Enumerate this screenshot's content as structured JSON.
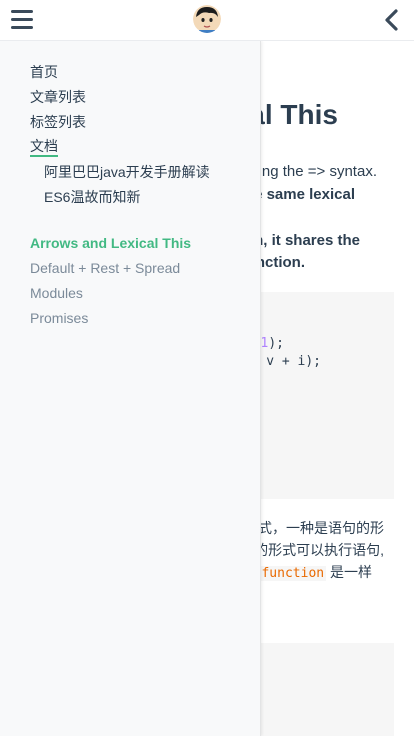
{
  "navbar": {
    "menu_icon": "hamburger-icon",
    "avatar_icon": "avatar",
    "back_icon": "chevron-left-icon"
  },
  "sidebar": {
    "items": [
      {
        "label": "首页"
      },
      {
        "label": "文章列表"
      },
      {
        "label": "标签列表"
      },
      {
        "label": "文档",
        "active": true
      }
    ],
    "sub_items": [
      {
        "label": "阿里巴巴java开发手册解读"
      },
      {
        "label": "ES6温故而知新"
      }
    ],
    "toc": [
      {
        "label": "Arrows and Lexical This",
        "current": true
      },
      {
        "label": "Default + Rest + Spread"
      },
      {
        "label": "Modules"
      },
      {
        "label": "Promises"
      }
    ]
  },
  "content": {
    "title_fragment": "al This",
    "p1": "sing the => syntax.",
    "p2": "e same lexical",
    "p3": "n, it shares the",
    "p4": "nction.",
    "code": {
      "line1_num": "1",
      "line1_rest": ");",
      "line2": "› v + i);"
    },
    "zh1": "式，一种是语句的形",
    "zh2": "的形式可以执行语句,",
    "zh3_code": "function",
    "zh3_rest": " 是一样"
  },
  "colors": {
    "accent": "#42b983",
    "text": "#2c3e50",
    "muted": "#7b8a99",
    "sidebar_bg": "#f8f9fa",
    "code_bg": "#f6f6f6",
    "keyword": "#e96900",
    "number": "#ae81ff"
  }
}
